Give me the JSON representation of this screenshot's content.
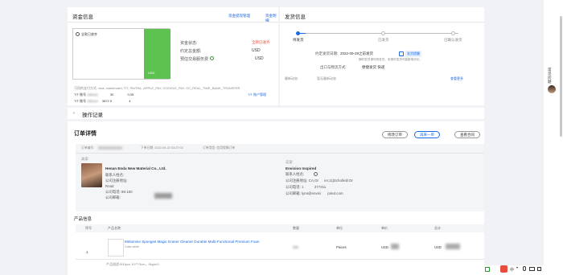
{
  "funds": {
    "title": "资金信息",
    "link_manage": "资金提现管理",
    "link_detail": "资金明细",
    "status_label": "全款已收齐",
    "fields": [
      {
        "label": "资金状态:",
        "value": "全款已收齐"
      },
      {
        "label": "约定总金额:",
        "value": "USD"
      },
      {
        "label": "预估交易服务费",
        "value": "USD"
      }
    ],
    "card_currency": "USD",
    "payment_methods": "可用的支付方式: visa, mastercard, T/T, PAYPAL, APPLE_PAY, GOOGLE_PAY, GC_REAL_TIME_BANK_TRANSFER",
    "tt_rows": [
      {
        "label": "T/T 账号",
        "brand": "citibank",
        "mid": "30",
        "right": "0:35"
      },
      {
        "label": "T/T 账号",
        "brand": "citibank",
        "mid": "3872 5",
        "right": "4"
      }
    ],
    "tt_link": "T/T 账户管理"
  },
  "shipping": {
    "title": "发货信息",
    "steps": [
      "待发货",
      "已发货",
      "已确认收货"
    ],
    "deadline_label": "约定发货日期:",
    "deadline_value": "2022-09-29之前发货",
    "deadline_tag": "发货提醒",
    "note": "随时发货请尽快发货，未按时发货可能影响评价。",
    "logistics_label": "出口与物流方式:",
    "logistics_value": "便捷发货 快递",
    "latest_label": "最新动态:",
    "latest_value": "暂无最新动态",
    "view_more": "查看更多"
  },
  "ops": {
    "title": "操作记录"
  },
  "order": {
    "title": "订单详情",
    "buttons": [
      "修改订单",
      "再来一单",
      "查看合同"
    ],
    "meta": {
      "order_no_label": "订单编号:",
      "order_time": "下单日期: 2022-09-22 03:27:03",
      "order_type": "订单类型: 信用保障订单"
    },
    "seller": {
      "heading": "卖家:",
      "company": "Henan Enda New Material Co., Ltd.",
      "contact": "联系人姓名:",
      "address": "公司注册地址:",
      "address_line": "Road",
      "phone": "公司电话: 86-150",
      "email": "公司邮箱:"
    },
    "buyer": {
      "heading": "买家:",
      "company": "Envision Inspired",
      "contact": "联系人姓名:",
      "address": "公司注册地址: CA,Or      ier,11]Schofield Dr",
      "phone": "公司电话: 1           277211",
      "email": "公司邮箱: lynn@envisi       pired.com"
    }
  },
  "products": {
    "title": "产品信息",
    "headers": [
      "序号",
      "产品名称",
      "数量",
      "单位",
      "单价",
      "总计"
    ],
    "rows": [
      {
        "index": "1",
        "name": "Melamine Sponges Magic Eraser Cleaner Durable Multi-Functional Premium Foan",
        "sub": "Color:white",
        "qty": "500",
        "unit": "Pieces",
        "price": "USD",
        "total": "USD"
      }
    ],
    "desc": "产品描述:500pcs 10*7*3cm，8kg/m3"
  },
  "sidebar": {
    "label": "常见问题"
  }
}
